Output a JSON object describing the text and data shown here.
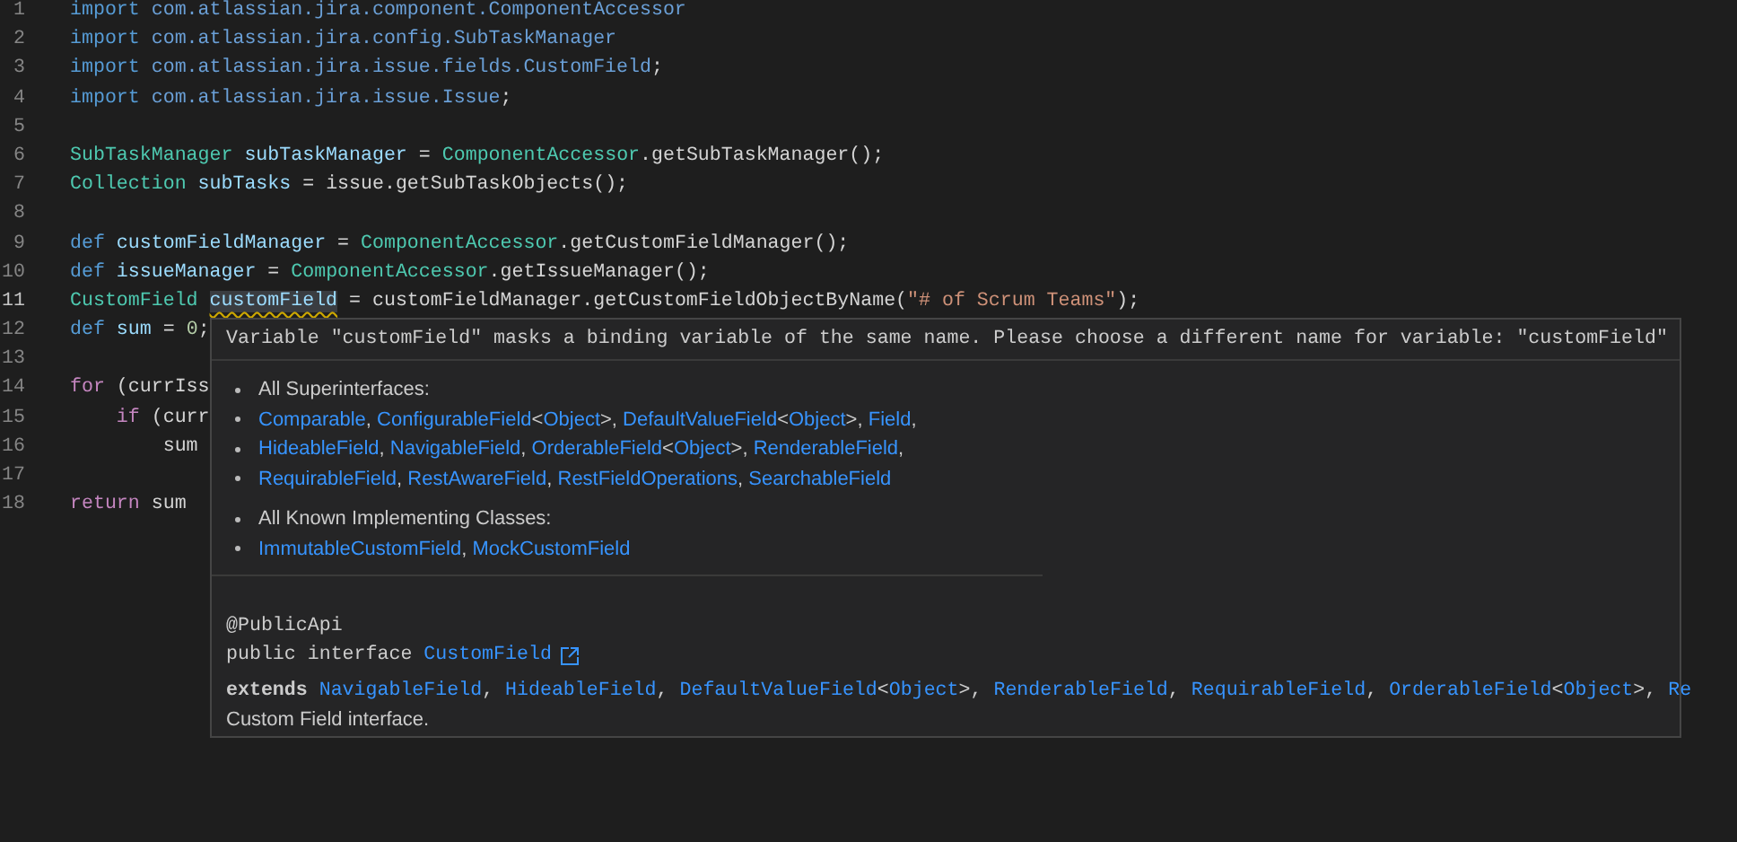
{
  "editor": {
    "lines": [
      {
        "number": "1",
        "tokens": [
          {
            "kind": "keyword",
            "text": "import"
          },
          {
            "kind": "package",
            "text": " com.atlassian.jira.component.ComponentAccessor"
          }
        ]
      },
      {
        "number": "2",
        "tokens": [
          {
            "kind": "keyword",
            "text": "import"
          },
          {
            "kind": "package",
            "text": " com.atlassian.jira.config.SubTaskManager"
          }
        ]
      },
      {
        "number": "3",
        "tokens": [
          {
            "kind": "keyword",
            "text": "import"
          },
          {
            "kind": "package",
            "text": " com.atlassian.jira.issue.fields.CustomField"
          },
          {
            "kind": "plain",
            "text": ";"
          }
        ]
      },
      {
        "number": "4",
        "tokens": [
          {
            "kind": "keyword",
            "text": "import"
          },
          {
            "kind": "package",
            "text": " com.atlassian.jira.issue.Issue"
          },
          {
            "kind": "plain",
            "text": ";"
          }
        ]
      },
      {
        "number": "5"
      },
      {
        "number": "6",
        "tokens": [
          {
            "kind": "type",
            "text": "SubTaskManager"
          },
          {
            "kind": "variable",
            "text": " subTaskManager"
          },
          {
            "kind": "plain",
            "text": " = "
          },
          {
            "kind": "type",
            "text": "ComponentAccessor"
          },
          {
            "kind": "plain",
            "text": ".getSubTaskManager();"
          }
        ]
      },
      {
        "number": "7",
        "tokens": [
          {
            "kind": "type",
            "text": "Collection"
          },
          {
            "kind": "variable",
            "text": " subTasks"
          },
          {
            "kind": "plain",
            "text": " = issue.getSubTaskObjects();"
          }
        ]
      },
      {
        "number": "8"
      },
      {
        "number": "9",
        "tokens": [
          {
            "kind": "keyword",
            "text": "def"
          },
          {
            "kind": "variable",
            "text": " customFieldManager"
          },
          {
            "kind": "plain",
            "text": " = "
          },
          {
            "kind": "type",
            "text": "ComponentAccessor"
          },
          {
            "kind": "plain",
            "text": ".getCustomFieldManager();"
          }
        ]
      },
      {
        "number": "10",
        "tokens": [
          {
            "kind": "keyword",
            "text": "def"
          },
          {
            "kind": "variable",
            "text": " issueManager"
          },
          {
            "kind": "plain",
            "text": " = "
          },
          {
            "kind": "type",
            "text": "ComponentAccessor"
          },
          {
            "kind": "plain",
            "text": ".getIssueManager();"
          }
        ]
      },
      {
        "number": "11",
        "current": true,
        "tokens": [
          {
            "kind": "type",
            "text": "CustomField "
          },
          {
            "kind": "warning",
            "text": "customField"
          },
          {
            "kind": "plain",
            "text": " = customFieldManager.getCustomFieldObjectByName("
          },
          {
            "kind": "string",
            "text": "\"# of Scrum Teams\""
          },
          {
            "kind": "plain",
            "text": ");"
          }
        ]
      },
      {
        "number": "12",
        "tokens": [
          {
            "kind": "keyword",
            "text": "def"
          },
          {
            "kind": "variable",
            "text": " sum"
          },
          {
            "kind": "plain",
            "text": " = "
          },
          {
            "kind": "number",
            "text": "0"
          },
          {
            "kind": "plain",
            "text": ";"
          }
        ]
      },
      {
        "number": "13"
      },
      {
        "number": "14",
        "tokens": [
          {
            "kind": "control",
            "text": "for"
          },
          {
            "kind": "plain",
            "text": " (currIss"
          }
        ]
      },
      {
        "number": "15",
        "tokens": [
          {
            "kind": "control",
            "text": "    if"
          },
          {
            "kind": "plain",
            "text": " (curr"
          }
        ]
      },
      {
        "number": "16",
        "tokens": [
          {
            "kind": "plain",
            "text": "        sum"
          }
        ]
      },
      {
        "number": "17"
      },
      {
        "number": "18",
        "tokens": [
          {
            "kind": "control",
            "text": "return"
          },
          {
            "kind": "plain",
            "text": " sum"
          }
        ]
      }
    ]
  },
  "hover": {
    "message": "Variable \"customField\" masks a binding variable of the same name. Please choose a different name for variable: \"customField\"",
    "superinterfaces": {
      "heading": "All Superinterfaces:",
      "lines": [
        [
          {
            "kind": "link",
            "text": "Comparable"
          },
          {
            "kind": "plain",
            "text": ", "
          },
          {
            "kind": "link",
            "text": "ConfigurableField"
          },
          {
            "kind": "plain",
            "text": "<"
          },
          {
            "kind": "link",
            "text": "Object"
          },
          {
            "kind": "plain",
            "text": ">, "
          },
          {
            "kind": "link",
            "text": "DefaultValueField"
          },
          {
            "kind": "plain",
            "text": "<"
          },
          {
            "kind": "link",
            "text": "Object"
          },
          {
            "kind": "plain",
            "text": ">, "
          },
          {
            "kind": "link",
            "text": "Field"
          },
          {
            "kind": "plain",
            "text": ","
          }
        ],
        [
          {
            "kind": "link",
            "text": "HideableField"
          },
          {
            "kind": "plain",
            "text": ", "
          },
          {
            "kind": "link",
            "text": "NavigableField"
          },
          {
            "kind": "plain",
            "text": ", "
          },
          {
            "kind": "link",
            "text": "OrderableField"
          },
          {
            "kind": "plain",
            "text": "<"
          },
          {
            "kind": "link",
            "text": "Object"
          },
          {
            "kind": "plain",
            "text": ">, "
          },
          {
            "kind": "link",
            "text": "RenderableField"
          },
          {
            "kind": "plain",
            "text": ","
          }
        ],
        [
          {
            "kind": "link",
            "text": "RequirableField"
          },
          {
            "kind": "plain",
            "text": ", "
          },
          {
            "kind": "link",
            "text": "RestAwareField"
          },
          {
            "kind": "plain",
            "text": ", "
          },
          {
            "kind": "link",
            "text": "RestFieldOperations"
          },
          {
            "kind": "plain",
            "text": ", "
          },
          {
            "kind": "link",
            "text": "SearchableField"
          }
        ]
      ]
    },
    "implementing_classes": {
      "heading": "All Known Implementing Classes:",
      "lines": [
        [
          {
            "kind": "link",
            "text": "ImmutableCustomField"
          },
          {
            "kind": "plain",
            "text": ", "
          },
          {
            "kind": "link",
            "text": "MockCustomField"
          }
        ]
      ]
    },
    "annotation": "@PublicApi",
    "declaration": [
      {
        "kind": "plain",
        "text": "public interface "
      },
      {
        "kind": "link",
        "text": "CustomField"
      }
    ],
    "extends": [
      {
        "kind": "keyword",
        "text": "extends "
      },
      {
        "kind": "link",
        "text": "NavigableField"
      },
      {
        "kind": "plain",
        "text": ", "
      },
      {
        "kind": "link",
        "text": "HideableField"
      },
      {
        "kind": "plain",
        "text": ", "
      },
      {
        "kind": "link",
        "text": "DefaultValueField"
      },
      {
        "kind": "plain",
        "text": "<"
      },
      {
        "kind": "link",
        "text": "Object"
      },
      {
        "kind": "plain",
        "text": ">, "
      },
      {
        "kind": "link",
        "text": "RenderableField"
      },
      {
        "kind": "plain",
        "text": ", "
      },
      {
        "kind": "link",
        "text": "RequirableField"
      },
      {
        "kind": "plain",
        "text": ", "
      },
      {
        "kind": "link",
        "text": "OrderableField"
      },
      {
        "kind": "plain",
        "text": "<"
      },
      {
        "kind": "link",
        "text": "Object"
      },
      {
        "kind": "plain",
        "text": ">, "
      },
      {
        "kind": "link",
        "text": "Re"
      }
    ],
    "description": "Custom Field interface."
  }
}
